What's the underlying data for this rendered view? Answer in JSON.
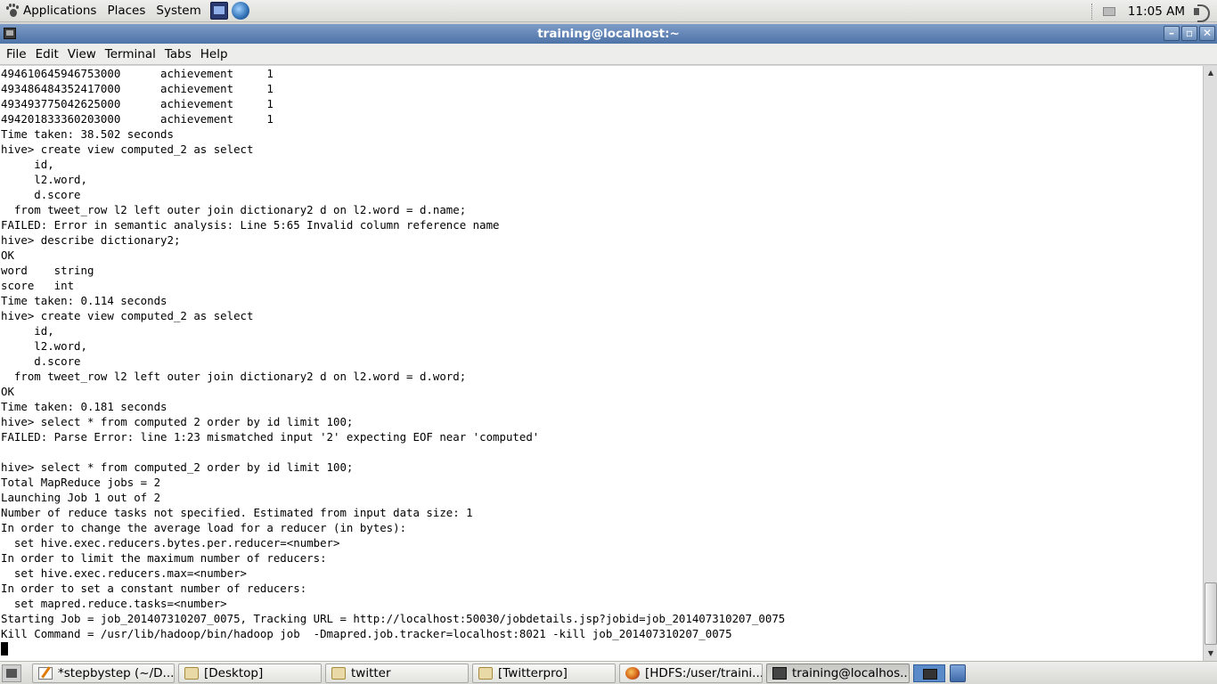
{
  "top_panel": {
    "menus": [
      "Applications",
      "Places",
      "System"
    ],
    "clock": "11:05 AM"
  },
  "window": {
    "title": "training@localhost:~",
    "menu": [
      "File",
      "Edit",
      "View",
      "Terminal",
      "Tabs",
      "Help"
    ]
  },
  "terminal": {
    "lines": [
      "494610645946753000      achievement     1",
      "493486484352417000      achievement     1",
      "493493775042625000      achievement     1",
      "494201833360203000      achievement     1",
      "Time taken: 38.502 seconds",
      "hive> create view computed_2 as select",
      "     id,",
      "     l2.word,",
      "     d.score",
      "  from tweet_row l2 left outer join dictionary2 d on l2.word = d.name;",
      "FAILED: Error in semantic analysis: Line 5:65 Invalid column reference name",
      "hive> describe dictionary2;",
      "OK",
      "word    string",
      "score   int",
      "Time taken: 0.114 seconds",
      "hive> create view computed_2 as select",
      "     id,",
      "     l2.word,",
      "     d.score",
      "  from tweet_row l2 left outer join dictionary2 d on l2.word = d.word;",
      "OK",
      "Time taken: 0.181 seconds",
      "hive> select * from computed 2 order by id limit 100;",
      "FAILED: Parse Error: line 1:23 mismatched input '2' expecting EOF near 'computed'",
      "",
      "hive> select * from computed_2 order by id limit 100;",
      "Total MapReduce jobs = 2",
      "Launching Job 1 out of 2",
      "Number of reduce tasks not specified. Estimated from input data size: 1",
      "In order to change the average load for a reducer (in bytes):",
      "  set hive.exec.reducers.bytes.per.reducer=<number>",
      "In order to limit the maximum number of reducers:",
      "  set hive.exec.reducers.max=<number>",
      "In order to set a constant number of reducers:",
      "  set mapred.reduce.tasks=<number>",
      "Starting Job = job_201407310207_0075, Tracking URL = http://localhost:50030/jobdetails.jsp?jobid=job_201407310207_0075",
      "Kill Command = /usr/lib/hadoop/bin/hadoop job  -Dmapred.job.tracker=localhost:8021 -kill job_201407310207_0075"
    ]
  },
  "taskbar": {
    "tasks": [
      {
        "label": "*stepbystep (~/D...",
        "icon": "text-editor-icon"
      },
      {
        "label": "[Desktop]",
        "icon": "folder-icon"
      },
      {
        "label": "twitter",
        "icon": "folder-icon"
      },
      {
        "label": "[Twitterpro]",
        "icon": "folder-icon"
      },
      {
        "label": "[HDFS:/user/traini...",
        "icon": "firefox-icon"
      },
      {
        "label": "training@localhos...",
        "icon": "terminal-icon"
      }
    ]
  }
}
